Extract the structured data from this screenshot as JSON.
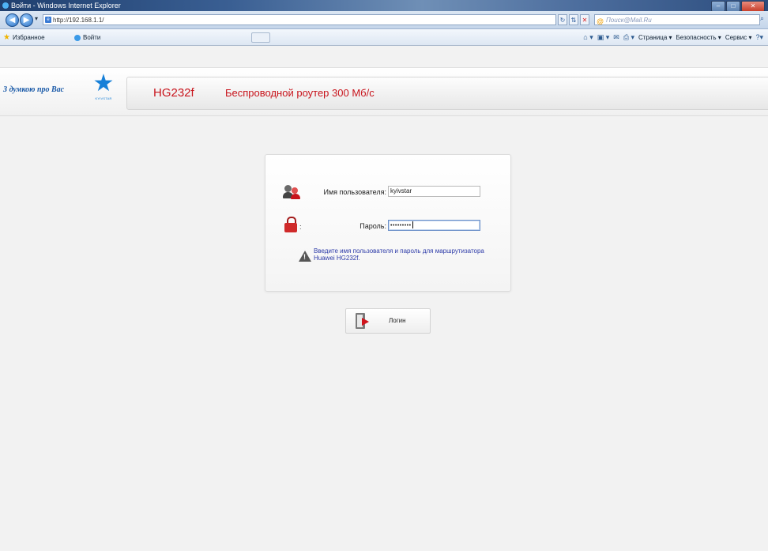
{
  "browser": {
    "title": "Войти - Windows Internet Explorer",
    "url": "http://192.168.1.1/",
    "search_placeholder": "Поиск@Mail.Ru",
    "favorites_label": "Избранное",
    "tab_label": "Войти",
    "commands": [
      "Страница ▾",
      "Безопасность ▾",
      "Сервис ▾"
    ]
  },
  "header": {
    "slogan": "З думкою про Вас",
    "brand_caption": "KYIVSTAR",
    "model": "HG232f",
    "product": "Беспроводной роутер 300 Мб/с"
  },
  "login": {
    "username_label": "Имя пользователя:",
    "username_value": "kyivstar",
    "password_label": "Пароль:",
    "password_mask": "•••••••••",
    "warning": "Введите имя пользователя и пароль для маршрутизатора Huawei HG232f.",
    "button_label": "Логин"
  },
  "colors": {
    "accent_red": "#c8141c",
    "brand_blue": "#1780d8",
    "warning_text": "#2c3aa8"
  }
}
